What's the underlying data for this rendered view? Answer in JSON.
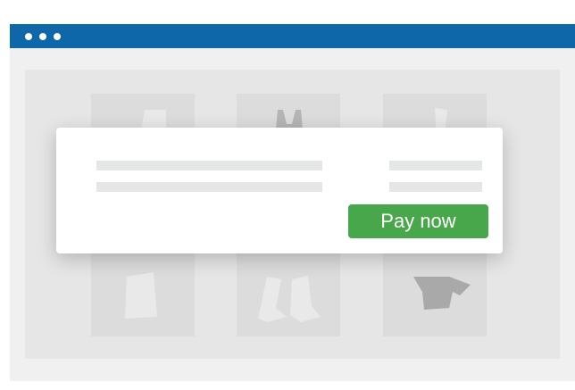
{
  "window": {
    "titlebar_color": "#0d67a8",
    "background_color": "#f0f0f0",
    "controls": [
      "window-dot-icon",
      "window-dot-icon",
      "window-dot-icon"
    ]
  },
  "products": [
    {
      "icon": "pants-icon"
    },
    {
      "icon": "dress-icon"
    },
    {
      "icon": "shirt-icon"
    }
  ],
  "modal": {
    "pay_button_label": "Pay now",
    "pay_button_color": "#48a74a"
  }
}
